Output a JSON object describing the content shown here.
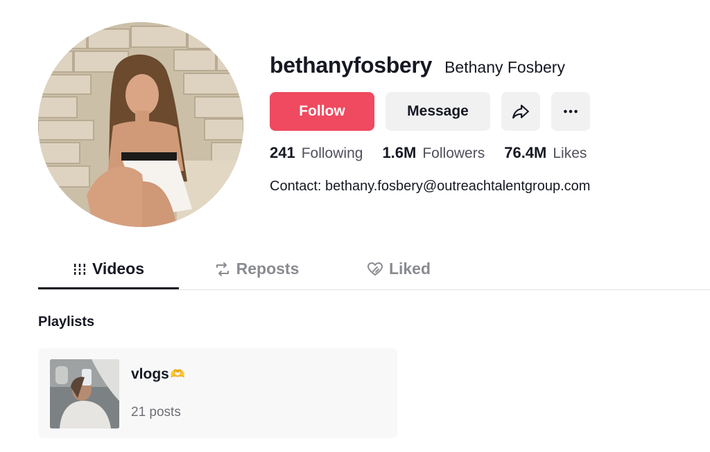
{
  "profile": {
    "username": "bethanyfosbery",
    "nickname": "Bethany Fosbery",
    "contact": "Contact: bethany.fosbery@outreachtalentgroup.com"
  },
  "actions": {
    "follow_label": "Follow",
    "message_label": "Message",
    "share_icon": "share-icon",
    "more_icon": "more-icon"
  },
  "stats": {
    "following": {
      "value": "241",
      "label": "Following"
    },
    "followers": {
      "value": "1.6M",
      "label": "Followers"
    },
    "likes": {
      "value": "76.4M",
      "label": "Likes"
    }
  },
  "tabs": [
    {
      "label": "Videos",
      "icon": "grid-icon",
      "active": true
    },
    {
      "label": "Reposts",
      "icon": "repost-icon",
      "active": false
    },
    {
      "label": "Liked",
      "icon": "liked-icon",
      "active": false
    }
  ],
  "playlists": {
    "section_title": "Playlists",
    "items": [
      {
        "name": "vlogs",
        "emoji": "🫶",
        "count": "21 posts"
      }
    ]
  },
  "colors": {
    "accent": "#ef4a5f",
    "button_bg": "#f1f1f2",
    "text": "#161823",
    "muted": "#8a8b91"
  }
}
